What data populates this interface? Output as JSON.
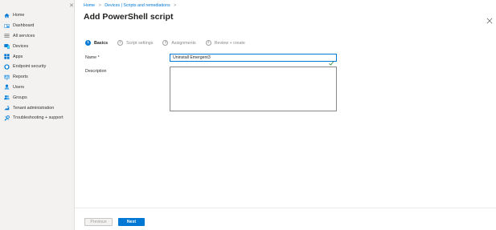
{
  "sidebar": {
    "items": [
      {
        "label": "Home",
        "icon": "home-icon"
      },
      {
        "label": "Dashboard",
        "icon": "dashboard-icon"
      },
      {
        "label": "All services",
        "icon": "all-services-icon"
      },
      {
        "label": "Devices",
        "icon": "devices-icon"
      },
      {
        "label": "Apps",
        "icon": "apps-icon"
      },
      {
        "label": "Endpoint security",
        "icon": "endpoint-security-icon"
      },
      {
        "label": "Reports",
        "icon": "reports-icon"
      },
      {
        "label": "Users",
        "icon": "users-icon"
      },
      {
        "label": "Groups",
        "icon": "groups-icon"
      },
      {
        "label": "Tenant administration",
        "icon": "tenant-admin-icon"
      },
      {
        "label": "Troubleshooting + support",
        "icon": "troubleshooting-icon"
      }
    ]
  },
  "breadcrumb": {
    "items": [
      "Home",
      "Devices | Scripts and remediations"
    ],
    "separator": ">"
  },
  "page": {
    "title": "Add PowerShell script",
    "more": "···"
  },
  "wizard": {
    "steps": [
      {
        "number": "1",
        "label": "Basics"
      },
      {
        "number": "2",
        "label": "Script settings"
      },
      {
        "number": "3",
        "label": "Assignments"
      },
      {
        "number": "4",
        "label": "Review + create"
      }
    ],
    "active_step": 1
  },
  "form": {
    "name_label": "Name *",
    "name_value": "Uninstall Emergent3",
    "description_label": "Description",
    "description_value": ""
  },
  "footer": {
    "previous_label": "Previous",
    "next_label": "Next"
  },
  "colors": {
    "accent": "#0078d4",
    "sidebar_bg": "#f3f2f1"
  }
}
